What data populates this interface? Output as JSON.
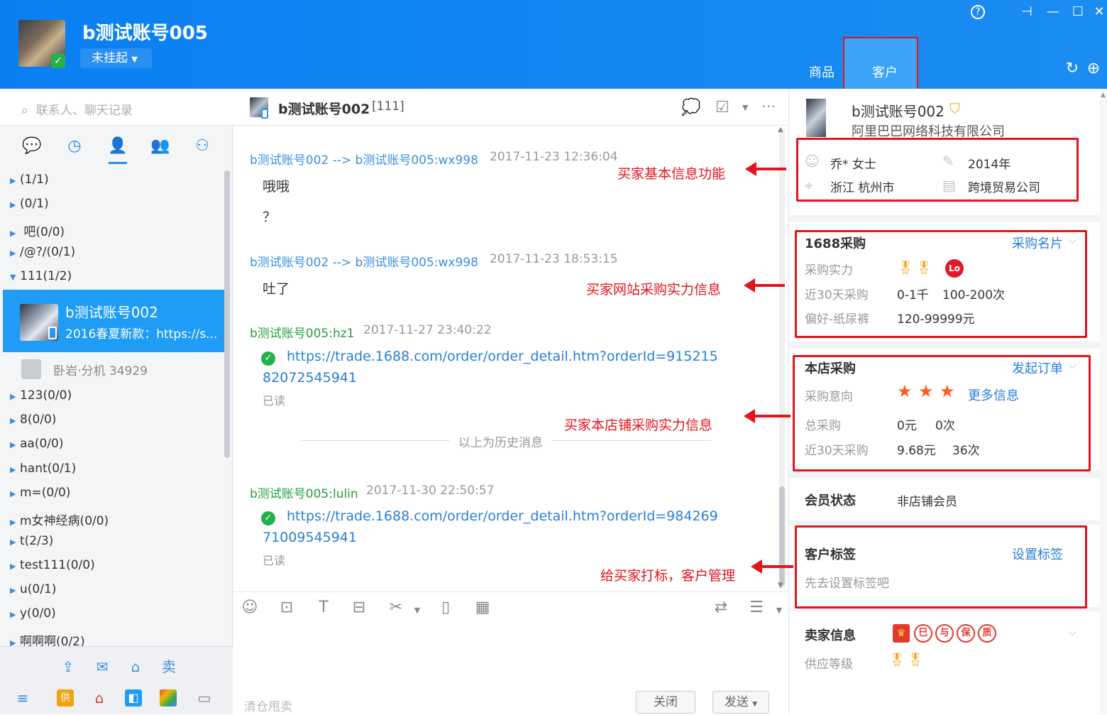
{
  "header": {
    "account_name": "b测试账号005",
    "status": "未挂起",
    "tabs": [
      {
        "label": "商品"
      },
      {
        "label": "客户"
      }
    ]
  },
  "left": {
    "search_placeholder": "联系人、聊天记录",
    "groups_top": [
      "(1/1)",
      "(0/1)",
      "吧(0/0)",
      "/@?/(0/1)",
      "111(1/2)"
    ],
    "selected_contact": {
      "name": "b测试账号002",
      "preview": "2016春夏新款：https://s..."
    },
    "sub_contact": "卧岩·分机 34929",
    "groups_bottom": [
      "123(0/0)",
      "8(0/0)",
      "aa(0/0)",
      "hant(0/1)",
      "m=(0/0)",
      "m女神经病(0/0)",
      "t(2/3)",
      "test111(0/0)",
      "u(0/1)",
      "y(0/0)",
      "啊啊啊(0/2)"
    ],
    "shop_tool_label": "卖"
  },
  "chat": {
    "title": "b测试账号002",
    "count": "[111]",
    "messages": [
      {
        "from": "b测试账号002 --> b测试账号005:wx998",
        "time": "2017-11-23 12:36:04",
        "lines": [
          "哦哦",
          "？"
        ]
      },
      {
        "from": "b测试账号002 --> b测试账号005:wx998",
        "time": "2017-11-23 18:53:15",
        "lines": [
          "吐了"
        ]
      },
      {
        "from": "b测试账号005:hz1",
        "time": "2017-11-27 23:40:22",
        "link1": "https://trade.1688.com/order/order_detail.htm?orderId=915215",
        "link2": "82072545941",
        "read": "已读"
      },
      {
        "from": "b测试账号005:lulin",
        "time": "2017-11-30 22:50:57",
        "link1": "https://trade.1688.com/order/order_detail.htm?orderId=984269",
        "link2": "71009545941",
        "read": "已读"
      }
    ],
    "history_divider": "以上为历史消息",
    "input_placeholder": "清仓甩卖",
    "close_label": "关闭",
    "send_label": "发送"
  },
  "customer": {
    "name": "b测试账号002",
    "company": "阿里巴巴网络科技有限公司",
    "basic": {
      "contact": "乔* 女士",
      "year": "2014年",
      "location": "浙江 杭州市",
      "type": "跨境贸易公司"
    },
    "purchase_1688": {
      "title": "1688采购",
      "link": "采购名片",
      "power_label": "采购实力",
      "lo_badge": "Lo",
      "recent_label": "近30天采购",
      "recent_amount": "0-1千",
      "recent_count": "100-200次",
      "pref_label": "偏好-纸尿裤",
      "pref_value": "120-99999元"
    },
    "shop_purchase": {
      "title": "本店采购",
      "link": "发起订单",
      "intent_label": "采购意向",
      "intent_stars": 3,
      "more_link": "更多信息",
      "total_label": "总采购",
      "total_amount": "0元",
      "total_count": "0次",
      "recent_label": "近30天采购",
      "recent_amount": "9.68元",
      "recent_count": "36次"
    },
    "member": {
      "label": "会员状态",
      "value": "非店铺会员"
    },
    "tags": {
      "title": "客户标签",
      "link": "设置标签",
      "placeholder": "先去设置标签吧"
    },
    "seller": {
      "title": "卖家信息",
      "badges": [
        "巳",
        "与",
        "保",
        "质"
      ],
      "supply_label": "供应等级"
    }
  },
  "annotations": [
    "买家基本信息功能",
    "买家网站采购实力信息",
    "买家本店铺采购实力信息",
    "给买家打标，客户管理"
  ],
  "colors": {
    "header_blue": "#0a7ff2",
    "selected_blue": "#1e9cf6",
    "annotation_red": "#e5131b",
    "link_blue": "#2a7fd8",
    "star_orange": "#ff5a1f",
    "ok_green": "#23b14d"
  }
}
